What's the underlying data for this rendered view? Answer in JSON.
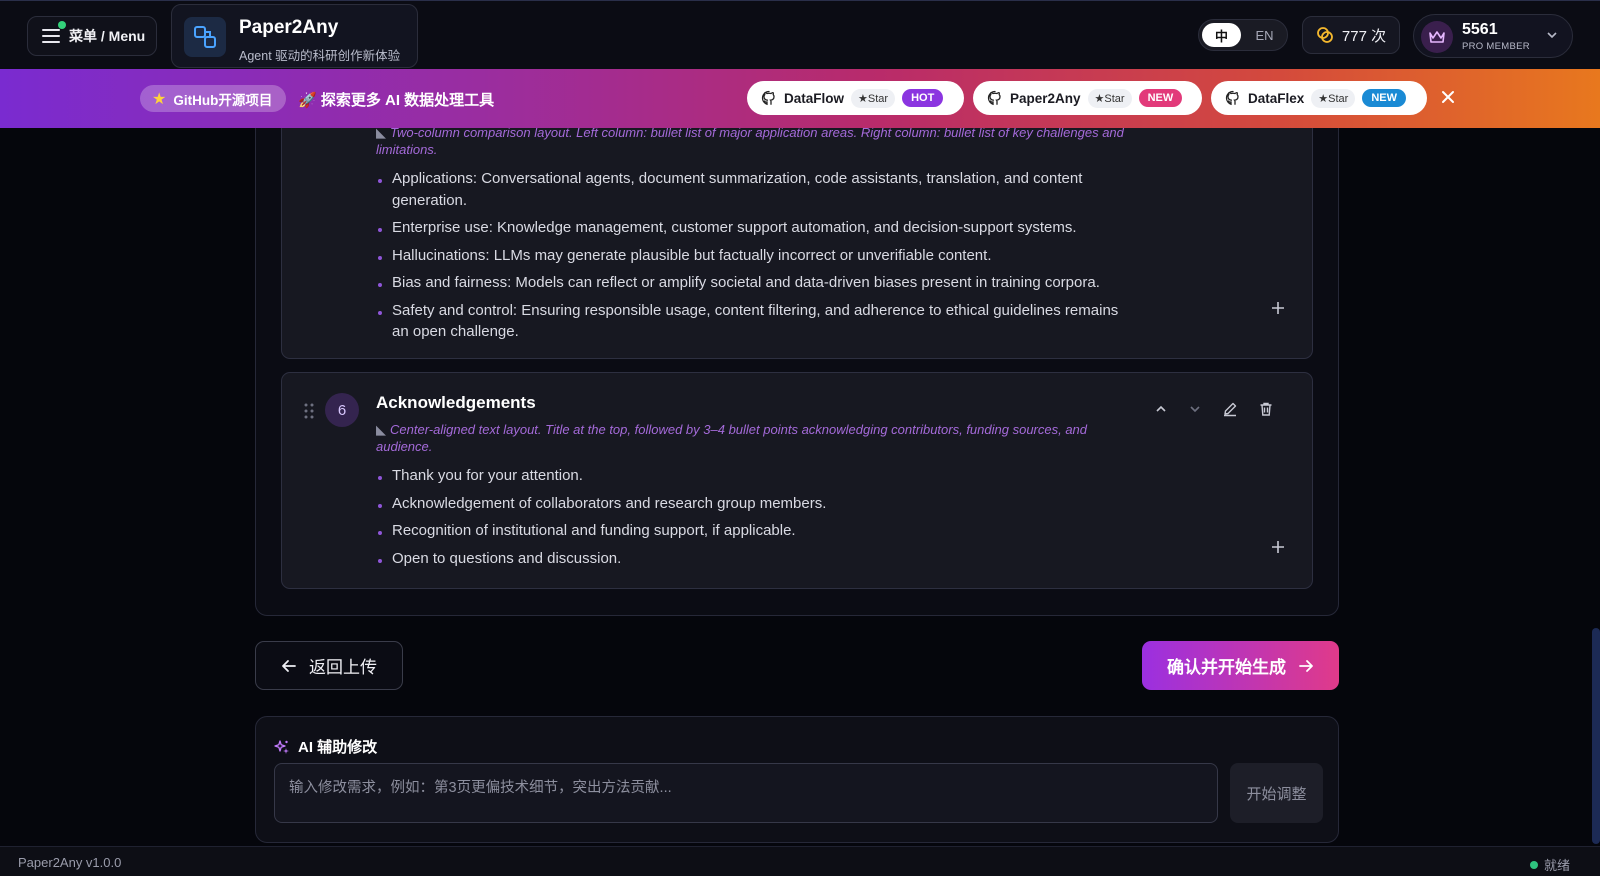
{
  "header": {
    "menu_label": "菜单 / Menu",
    "brand_title": "Paper2Any",
    "brand_subtitle": "Agent 驱动的科研创作新体验",
    "lang_zh": "中",
    "lang_en": "EN",
    "credits": "777 次",
    "member_points": "5561",
    "member_tier": "PRO MEMBER"
  },
  "banner": {
    "github_label": "GitHub开源项目",
    "explore_text": "🚀 探索更多 AI 数据处理工具",
    "repos": [
      {
        "name": "DataFlow",
        "star": "★Star",
        "badge": "HOT",
        "badge_color": "#8b35e0"
      },
      {
        "name": "Paper2Any",
        "star": "★Star",
        "badge": "NEW",
        "badge_color": "#e23a7a"
      },
      {
        "name": "DataFlex",
        "star": "★Star",
        "badge": "NEW",
        "badge_color": "#1a8ad4"
      }
    ]
  },
  "sections": {
    "s5": {
      "layout_note": "Two-column comparison layout. Left column: bullet list of major application areas. Right column: bullet list of key challenges and limitations.",
      "bullets": [
        "Applications: Conversational agents, document summarization, code assistants, translation, and content generation.",
        "Enterprise use: Knowledge management, customer support automation, and decision-support systems.",
        "Hallucinations: LLMs may generate plausible but factually incorrect or unverifiable content.",
        "Bias and fairness: Models can reflect or amplify societal and data-driven biases present in training corpora.",
        "Safety and control: Ensuring responsible usage, content filtering, and adherence to ethical guidelines remains an open challenge."
      ]
    },
    "s6": {
      "number": "6",
      "title": "Acknowledgements",
      "layout_note": "Center-aligned text layout. Title at the top, followed by 3–4 bullet points acknowledging contributors, funding sources, and audience.",
      "bullets": [
        "Thank you for your attention.",
        "Acknowledgement of collaborators and research group members.",
        "Recognition of institutional and funding support, if applicable.",
        "Open to questions and discussion."
      ]
    }
  },
  "actions": {
    "back_label": "返回上传",
    "confirm_label": "确认并开始生成"
  },
  "ai_assist": {
    "title": "AI 辅助修改",
    "placeholder": "输入修改需求，例如：第3页更偏技术细节，突出方法贡献...",
    "button_label": "开始调整"
  },
  "footer": {
    "version": "Paper2Any v1.0.0",
    "status": "就绪"
  }
}
